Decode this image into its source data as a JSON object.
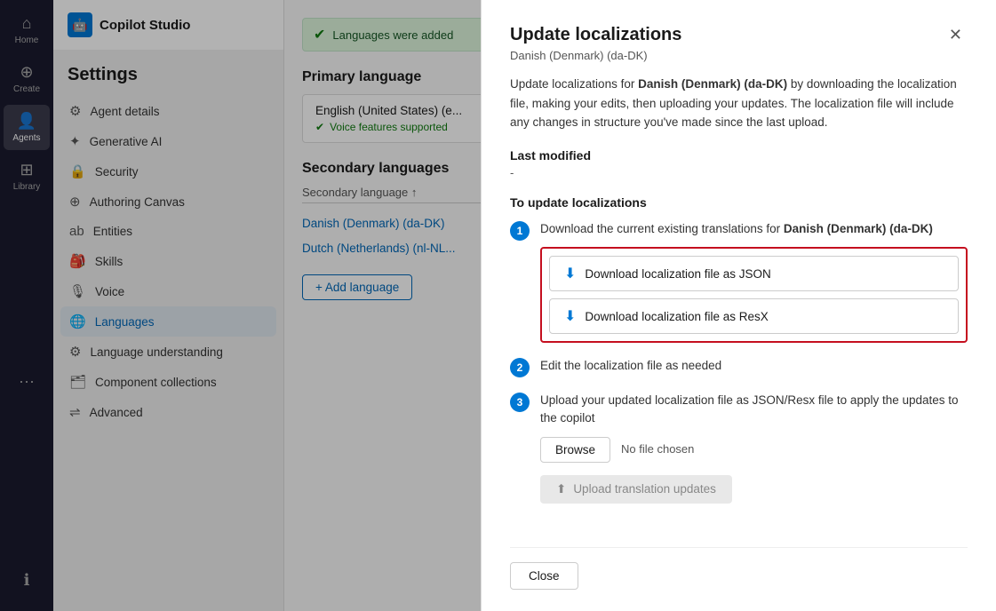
{
  "app": {
    "name": "Copilot Studio",
    "logo_icon": "🤖"
  },
  "sidebar": {
    "items": [
      {
        "id": "home",
        "label": "Home",
        "icon": "⌂",
        "active": false
      },
      {
        "id": "create",
        "label": "Create",
        "icon": "⊕",
        "active": false
      },
      {
        "id": "agents",
        "label": "Agents",
        "icon": "👤",
        "active": true
      },
      {
        "id": "library",
        "label": "Library",
        "icon": "⊞",
        "active": false
      },
      {
        "id": "more",
        "label": "...",
        "icon": "•••",
        "active": false
      }
    ],
    "info_icon": "ℹ"
  },
  "settings": {
    "title": "Settings",
    "menu": [
      {
        "id": "agent-details",
        "label": "Agent details",
        "icon": "⚙",
        "active": false
      },
      {
        "id": "generative-ai",
        "label": "Generative AI",
        "icon": "✦",
        "active": false
      },
      {
        "id": "security",
        "label": "Security",
        "icon": "🔒",
        "active": false
      },
      {
        "id": "authoring-canvas",
        "label": "Authoring Canvas",
        "icon": "⊕",
        "active": false
      },
      {
        "id": "entities",
        "label": "Entities",
        "icon": "ab",
        "active": false
      },
      {
        "id": "skills",
        "label": "Skills",
        "icon": "🎒",
        "active": false
      },
      {
        "id": "voice",
        "label": "Voice",
        "icon": "🎙",
        "active": false
      },
      {
        "id": "languages",
        "label": "Languages",
        "icon": "🌐",
        "active": true
      },
      {
        "id": "language-understanding",
        "label": "Language understanding",
        "icon": "⚙",
        "active": false
      },
      {
        "id": "component-collections",
        "label": "Component collections",
        "icon": "🗂",
        "active": false
      },
      {
        "id": "advanced",
        "label": "Advanced",
        "icon": "⇌",
        "active": false
      }
    ]
  },
  "main": {
    "success_message": "Languages were added",
    "primary_language": {
      "section_title": "Primary language",
      "lang_name": "English (United States) (e...",
      "voice_label": "Voice features supported"
    },
    "secondary_languages": {
      "section_title": "Secondary languages",
      "column_header": "Secondary language ↑",
      "languages": [
        {
          "name": "Danish (Denmark) (da-DK)",
          "color": "#0067b8"
        },
        {
          "name": "Dutch (Netherlands) (nl-NL...",
          "color": "#0067b8"
        }
      ],
      "add_button": "+ Add language"
    }
  },
  "modal": {
    "title": "Update localizations",
    "subtitle": "Danish (Denmark) (da-DK)",
    "description": "Update localizations for Danish (Denmark) (da-DK) by downloading the localization file, making your edits, then uploading your updates. The localization file will include any changes in structure you've made since the last upload.",
    "bold_lang": "Danish (Denmark) (da-DK)",
    "last_modified_label": "Last modified",
    "last_modified_value": "-",
    "to_update_label": "To update localizations",
    "steps": [
      {
        "num": "1",
        "text": "Download the current existing translations for Danish (Denmark) (da-DK)"
      },
      {
        "num": "2",
        "text": "Edit the localization file as needed"
      },
      {
        "num": "3",
        "text": "Upload your updated localization file as JSON/Resx file to apply the updates to the copilot"
      }
    ],
    "download_json_label": "Download localization file as JSON",
    "download_resx_label": "Download localization file as ResX",
    "browse_label": "Browse",
    "no_file_label": "No file chosen",
    "upload_label": "Upload translation updates",
    "close_label": "Close",
    "download_icon": "⬇",
    "upload_icon": "⬆"
  }
}
